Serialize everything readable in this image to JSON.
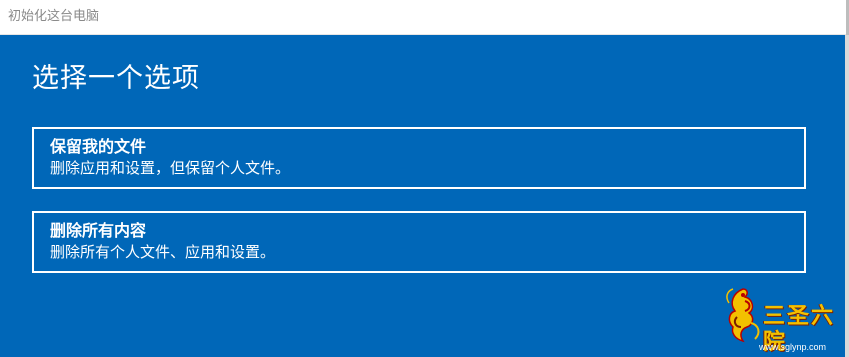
{
  "window": {
    "title": "初始化这台电脑"
  },
  "page": {
    "heading": "选择一个选项"
  },
  "options": [
    {
      "title": "保留我的文件",
      "description": "删除应用和设置，但保留个人文件。"
    },
    {
      "title": "删除所有内容",
      "description": "删除所有个人文件、应用和设置。"
    }
  ],
  "watermark": {
    "text": "三圣六院",
    "url": "www.sglynp.com"
  },
  "colors": {
    "background": "#0067b8",
    "foreground": "#ffffff",
    "watermark_gold": "#f3c000"
  }
}
